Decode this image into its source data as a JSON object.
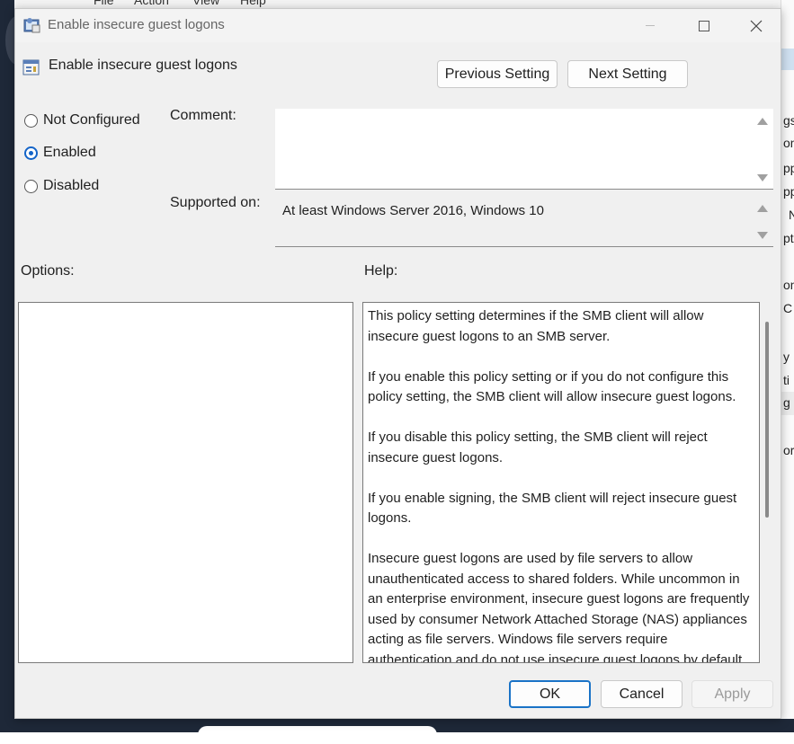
{
  "background": {
    "menu": [
      "File",
      "Action",
      "View",
      "Help"
    ],
    "right_fragments": [
      "gs",
      "on",
      "pp",
      "pp",
      "N",
      "pt",
      "on",
      "C s",
      "y",
      "ti",
      "g",
      "or"
    ]
  },
  "window": {
    "title": "Enable insecure guest logons",
    "minimize_label": "",
    "maximize_label": "",
    "close_label": "✕"
  },
  "header": {
    "policy_title": "Enable insecure guest logons",
    "previous_label": "Previous Setting",
    "next_label": "Next Setting"
  },
  "state": {
    "options": [
      {
        "label": "Not Configured",
        "checked": false
      },
      {
        "label": "Enabled",
        "checked": true
      },
      {
        "label": "Disabled",
        "checked": false
      }
    ]
  },
  "fields": {
    "comment_label": "Comment:",
    "comment_value": "",
    "supported_label": "Supported on:",
    "supported_value": "At least Windows Server 2016, Windows 10"
  },
  "sections": {
    "options_label": "Options:",
    "help_label": "Help:"
  },
  "help": {
    "paragraphs": [
      "This policy setting determines if the SMB client will allow insecure guest logons to an SMB server.",
      "If you enable this policy setting or if you do not configure this policy setting, the SMB client will allow insecure guest logons.",
      "If you disable this policy setting, the SMB client will reject insecure guest logons.",
      "If you enable signing, the SMB client will reject insecure guest logons.",
      "Insecure guest logons are used by file servers to allow unauthenticated access to shared folders. While uncommon in an enterprise environment, insecure guest logons are frequently used by consumer Network Attached Storage (NAS) appliances acting as file servers. Windows file servers require authentication and do not use insecure guest logons by default."
    ]
  },
  "footer": {
    "ok_label": "OK",
    "cancel_label": "Cancel",
    "apply_label": "Apply"
  },
  "colors": {
    "accent": "#1464c8",
    "dialog_bg": "#f0f0f0"
  }
}
